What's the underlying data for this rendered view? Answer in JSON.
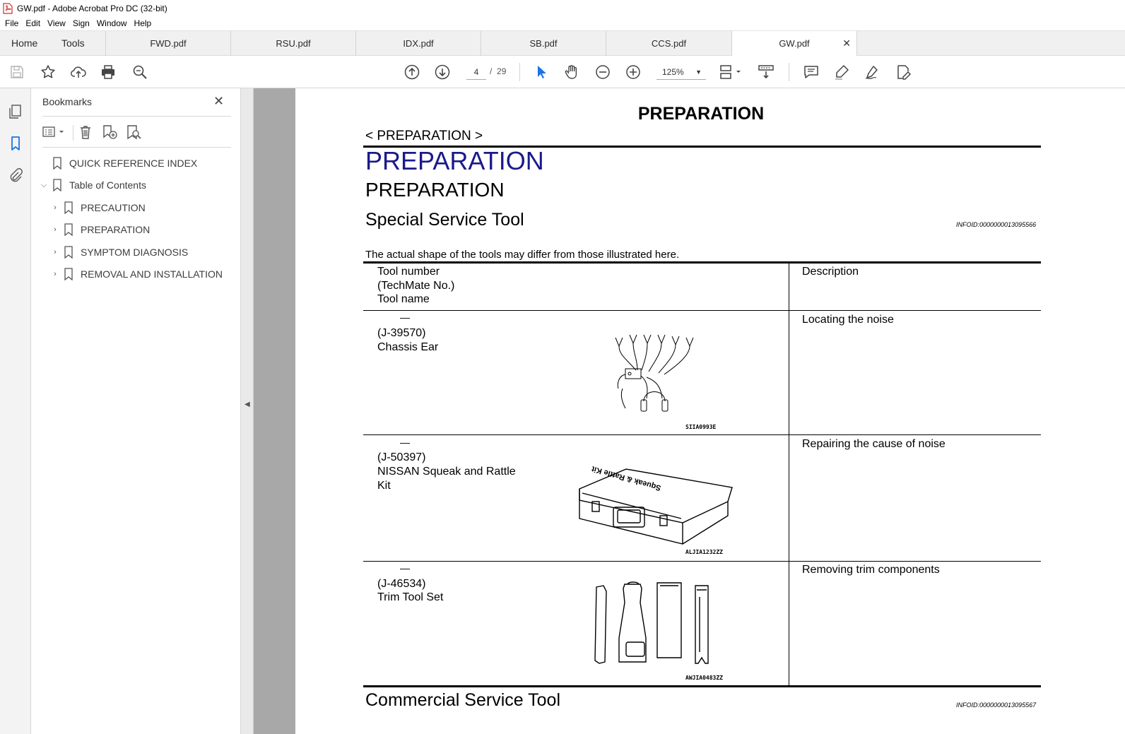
{
  "window": {
    "title": "GW.pdf - Adobe Acrobat Pro DC (32-bit)"
  },
  "menu": [
    "File",
    "Edit",
    "View",
    "Sign",
    "Window",
    "Help"
  ],
  "nav_tabs": [
    "Home",
    "Tools"
  ],
  "doc_tabs": [
    {
      "label": "FWD.pdf",
      "active": false
    },
    {
      "label": "RSU.pdf",
      "active": false
    },
    {
      "label": "IDX.pdf",
      "active": false
    },
    {
      "label": "SB.pdf",
      "active": false
    },
    {
      "label": "CCS.pdf",
      "active": false
    },
    {
      "label": "GW.pdf",
      "active": true
    }
  ],
  "toolbar": {
    "current_page": "4",
    "page_separator": "/",
    "total_pages": "29",
    "zoom": "125%",
    "icons": [
      "save-icon",
      "star-icon",
      "upload-icon",
      "print-icon",
      "zoom-search-icon",
      "page-up-icon",
      "page-down-icon",
      "select-cursor-icon",
      "hand-icon",
      "zoom-out-icon",
      "zoom-in-icon",
      "page-layout-icon",
      "scroll-mode-icon",
      "comment-icon",
      "highlight-icon",
      "sign-icon",
      "edit-icon"
    ]
  },
  "bookmarks": {
    "header": "Bookmarks",
    "items": [
      {
        "label": "QUICK REFERENCE INDEX",
        "level": 0,
        "expander": ""
      },
      {
        "label": "Table of Contents",
        "level": 0,
        "expander": "expanded"
      },
      {
        "label": "PRECAUTION",
        "level": 1,
        "expander": "collapsed"
      },
      {
        "label": "PREPARATION",
        "level": 1,
        "expander": "collapsed"
      },
      {
        "label": "SYMPTOM DIAGNOSIS",
        "level": 1,
        "expander": "collapsed"
      },
      {
        "label": "REMOVAL AND INSTALLATION",
        "level": 1,
        "expander": "collapsed"
      }
    ]
  },
  "document": {
    "page_header": "PREPARATION",
    "breadcrumb": "< PREPARATION >",
    "h1": "PREPARATION",
    "h2": "PREPARATION",
    "section_title": "Special Service Tool",
    "section_infoid": "INFOID:0000000013095566",
    "note": "The actual shape of the tools may differ from those illustrated here.",
    "table_headers": {
      "tool_line1": "Tool number",
      "tool_line2": "(TechMate No.)",
      "tool_line3": "Tool name",
      "description": "Description"
    },
    "tools": [
      {
        "dash": "—",
        "number": "(J-39570)",
        "name_line1": "Chassis Ear",
        "name_line2": "",
        "description": "Locating the noise",
        "figure_code": "SIIA0993E"
      },
      {
        "dash": "—",
        "number": "(J-50397)",
        "name_line1": "NISSAN Squeak and Rattle",
        "name_line2": "Kit",
        "description": "Repairing the cause of noise",
        "figure_code": "ALJIA1232ZZ"
      },
      {
        "dash": "—",
        "number": "(J-46534)",
        "name_line1": "Trim Tool Set",
        "name_line2": "",
        "description": "Removing trim components",
        "figure_code": "AWJIA0483ZZ"
      }
    ],
    "kit_lid_text": "Squeak & Rattle Kit",
    "next_section_title": "Commercial Service Tool",
    "next_section_infoid": "INFOID:0000000013095567"
  }
}
